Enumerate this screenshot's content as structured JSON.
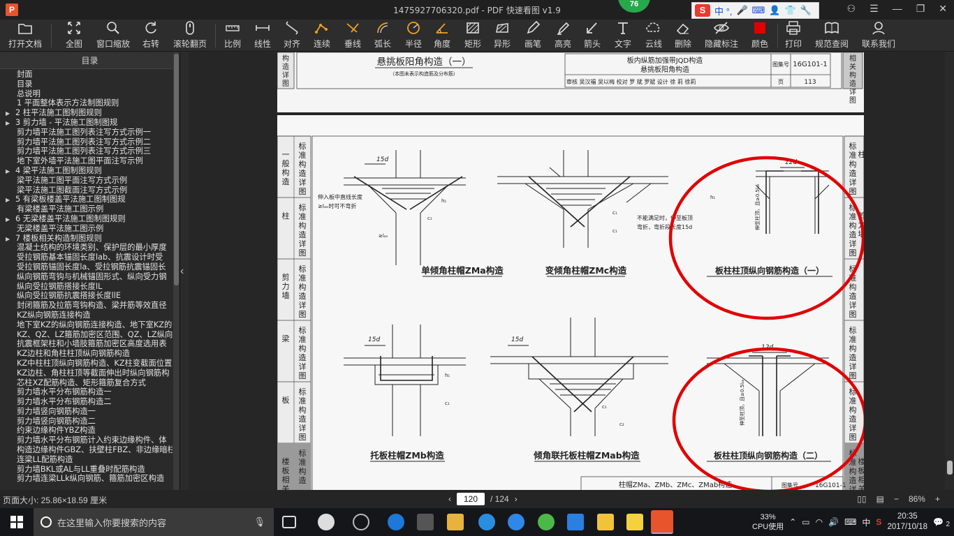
{
  "window": {
    "title": "1475927706320.pdf - PDF 快速看图 v1.9",
    "badge_count": "76",
    "ime_label": "中 °,"
  },
  "toolbar": [
    {
      "label": "打开文档",
      "icon": "folder-icon"
    },
    {
      "label": "全图",
      "icon": "fit-page-icon"
    },
    {
      "label": "窗口缩放",
      "icon": "zoom-icon"
    },
    {
      "label": "右转",
      "icon": "rotate-right-icon"
    },
    {
      "label": "滚轮翻页",
      "icon": "mouse-wheel-icon"
    },
    {
      "label": "比例",
      "icon": "scale-icon"
    },
    {
      "label": "线性",
      "icon": "linear-measure-icon"
    },
    {
      "label": "对齐",
      "icon": "align-measure-icon"
    },
    {
      "label": "连续",
      "icon": "continuous-measure-icon"
    },
    {
      "label": "垂线",
      "icon": "perpendicular-icon"
    },
    {
      "label": "弧长",
      "icon": "arc-length-icon"
    },
    {
      "label": "半径",
      "icon": "radius-icon"
    },
    {
      "label": "角度",
      "icon": "angle-icon"
    },
    {
      "label": "矩形",
      "icon": "rectangle-area-icon"
    },
    {
      "label": "异形",
      "icon": "polygon-area-icon"
    },
    {
      "label": "画笔",
      "icon": "pen-icon"
    },
    {
      "label": "高亮",
      "icon": "highlighter-icon"
    },
    {
      "label": "箭头",
      "icon": "arrow-icon"
    },
    {
      "label": "文字",
      "icon": "text-icon"
    },
    {
      "label": "云线",
      "icon": "cloud-line-icon"
    },
    {
      "label": "删除",
      "icon": "eraser-icon"
    },
    {
      "label": "隐藏标注",
      "icon": "hide-annotations-icon"
    },
    {
      "label": "颜色",
      "icon": "color-swatch-icon"
    },
    {
      "label": "打印",
      "icon": "printer-icon"
    },
    {
      "label": "规范查阅",
      "icon": "book-icon"
    },
    {
      "label": "联系我们",
      "icon": "contact-icon"
    }
  ],
  "accent_colors": {
    "annotation_red": "#e00000",
    "color_swatch": "#e00000",
    "badge_green": "#27a84a"
  },
  "sidebar": {
    "header": "目录",
    "items": [
      {
        "text": "封面",
        "level": 0
      },
      {
        "text": "目录",
        "level": 0
      },
      {
        "text": "总说明",
        "level": 0
      },
      {
        "text": "1 平面整体表示方法制图规则",
        "level": 0
      },
      {
        "text": "2 柱平法施工图制图规则",
        "level": 1
      },
      {
        "text": "3 剪力墙 - 平法施工图制图规",
        "level": 1
      },
      {
        "text": "剪力墙平法施工图列表注写方式示例一",
        "level": 2
      },
      {
        "text": "剪力墙平法施工图列表注写方式示例二",
        "level": 2
      },
      {
        "text": "剪力墙平法施工图列表注写方式示例三",
        "level": 2
      },
      {
        "text": "地下室外墙平法施工图平面注写示例",
        "level": 2
      },
      {
        "text": "4 梁平法施工图制图规则",
        "level": 1
      },
      {
        "text": "梁平法施工图平面注写方式示例",
        "level": 2
      },
      {
        "text": "梁平法施工图截面注写方式示例",
        "level": 2
      },
      {
        "text": "5 有梁板楼盖平法施工图制图规",
        "level": 1
      },
      {
        "text": "有梁楼盖平法施工图示例",
        "level": 2
      },
      {
        "text": "6 无梁楼盖平法施工图制图规则",
        "level": 1
      },
      {
        "text": "无梁楼盖平法施工图示例",
        "level": 2
      },
      {
        "text": "7 楼板相关构造制图规则",
        "level": 1
      },
      {
        "text": "混凝土结构的环境类别、保护层的最小厚度",
        "level": 2
      },
      {
        "text": "受拉钢筋基本锚固长度lab、抗震设计时受",
        "level": 2
      },
      {
        "text": "受拉钢筋锚固长度la、受拉钢筋抗震锚固长",
        "level": 2
      },
      {
        "text": "纵向钢筋弯钩与机械锚固形式、纵向受力钢",
        "level": 2
      },
      {
        "text": "纵向受拉钢筋搭接长度lL",
        "level": 2
      },
      {
        "text": "纵向受拉钢筋抗震搭接长度llE",
        "level": 2
      },
      {
        "text": "封闭箍筋及拉筋弯钩构造、梁并筋等效直径",
        "level": 2
      },
      {
        "text": "KZ纵向钢筋连接构造",
        "level": 2
      },
      {
        "text": "地下室KZ的纵向钢筋连接构造、地下室KZ的",
        "level": 2
      },
      {
        "text": "KZ、QZ、LZ箍筋加密区范围、QZ、LZ纵向钢",
        "level": 2
      },
      {
        "text": "抗震框架柱和小墙肢箍筋加密区高度选用表",
        "level": 2
      },
      {
        "text": "KZ边柱和角柱柱顶纵向钢筋构造",
        "level": 2
      },
      {
        "text": "KZ中柱柱顶纵向钢筋构造、KZ柱变截面位置",
        "level": 2
      },
      {
        "text": "KZ边柱、角柱柱顶等截面伸出时纵向钢筋构",
        "level": 2
      },
      {
        "text": "芯柱XZ配筋构造、矩形箍筋复合方式",
        "level": 2
      },
      {
        "text": "剪力墙水平分布钢筋构造一",
        "level": 2
      },
      {
        "text": "剪力墙水平分布钢筋构造二",
        "level": 2
      },
      {
        "text": "剪力墙竖向钢筋构造一",
        "level": 2
      },
      {
        "text": "剪力墙竖向钢筋构造二",
        "level": 2
      },
      {
        "text": "约束边缘构件YBZ构造",
        "level": 2
      },
      {
        "text": "剪力墙水平分布钢筋计入约束边缘构件、体",
        "level": 2
      },
      {
        "text": "构造边缘构件GBZ、扶壁柱FBZ、非边缘暗柱",
        "level": 2
      },
      {
        "text": "连梁LL配筋构造",
        "level": 2
      },
      {
        "text": "剪力墙BKL或AL与LL重叠时配筋构造",
        "level": 2
      },
      {
        "text": "剪力墙连梁LLk纵向钢筋、箍筋加密区构造",
        "level": 2
      }
    ]
  },
  "document": {
    "top_page": {
      "heading": "悬挑板阳角构造（一）",
      "note": "（本图未表示构造筋及分布筋）",
      "tb_title1": "板内纵筋加强带JQD构造",
      "tb_title2": "悬挑板阳角构造",
      "tb_atlas_label": "图集号",
      "tb_atlas": "16G101-1",
      "tb_row": "审核 吴汉福  吴以梅 校对 罗 斌   罗斌  设计 徐 莉   徐莉",
      "tb_page_label": "页",
      "tb_page": "113",
      "side_tab": "相关构造详图",
      "left_tab": "构造详图"
    },
    "left_tabs": [
      "标准构造详图",
      "一般构造",
      "标准构造详图",
      "柱",
      "标准构造详图",
      "剪力墙",
      "标准构造详图",
      "梁",
      "标准构造详图",
      "板"
    ],
    "left_tab_groups": [
      {
        "sub": "一般构造",
        "main": "标准构造详图"
      },
      {
        "sub": "柱",
        "main": "标准构造详图"
      },
      {
        "sub": "剪力墙",
        "main": "标准构造详图"
      },
      {
        "sub": "梁",
        "main": "标准构造详图"
      },
      {
        "sub": "板",
        "main": "标准构造详图"
      },
      {
        "sub": "楼板相关",
        "main": "标准构造"
      }
    ],
    "right_tabs": [
      "标准构造详图",
      "标准构造详图",
      "标准构造详图",
      "标准构造详图",
      "标准构造详图"
    ],
    "right_tab_partials": [
      "柱",
      "剪力墙",
      "",
      "",
      "",
      "楼板相关"
    ],
    "captions": {
      "c1": "单倾角柱帽ZMa构造",
      "c2": "变倾角柱帽ZMc构造",
      "c3": "板柱柱顶纵向钢筋构造（一）",
      "c4": "托板柱帽ZMb构造",
      "c5": "倾角联托板柱帽ZMab构造",
      "c6": "板柱柱顶纵向钢筋构造（二）"
    },
    "dims": {
      "d15": "15d",
      "d12": "12d",
      "c1": "c₁",
      "c2": "c₂",
      "h1": "h₁",
      "lae": "≥lₐₑ"
    },
    "notes": {
      "n1": "伸入板中直线长度",
      "n1b": "≥lₐₑ时可不弯折",
      "n2": "不能满足时，伸至板顶",
      "n2b": "弯折，弯折段长度15d",
      "n3": "伸至柱顶，且≥0.5lₐₑ",
      "n4": "伸至柱顶，且≥0.5lₐₑ"
    },
    "footer_title": "柱帽ZMa、ZMb、ZMc、ZMab构造",
    "footer_atlas": "16G101-1",
    "footer_atlas_label": "图集号"
  },
  "status": {
    "page_size": "页面大小: 25.86×18.59 厘米",
    "current_page": "120",
    "total_pages": "/ 124",
    "zoom": "86%"
  },
  "taskbar": {
    "search_placeholder": "在这里输入你要搜索的内容",
    "cpu_percent": "33%",
    "cpu_label": "CPU使用",
    "ime": "中",
    "time": "20:35",
    "date": "2017/10/18",
    "notification_count": "2"
  }
}
